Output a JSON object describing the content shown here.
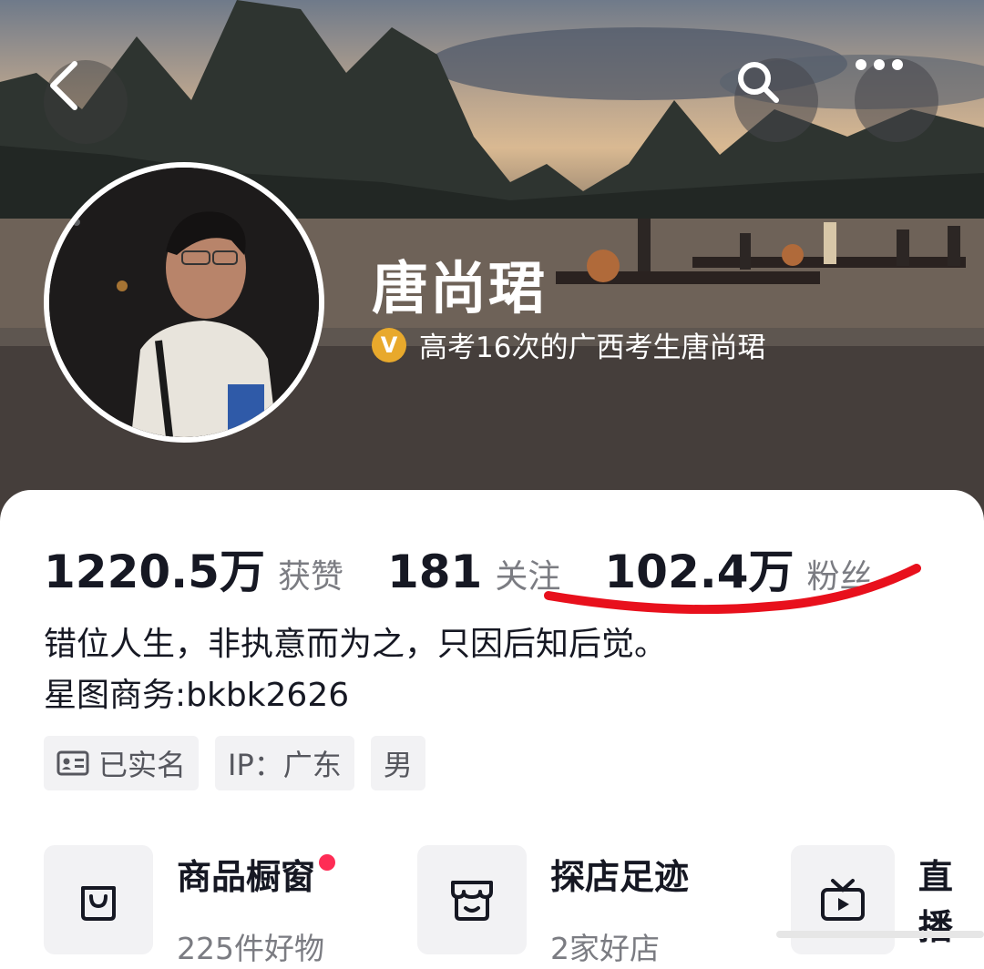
{
  "header": {
    "back_icon": "chevron-left-icon",
    "search_icon": "search-icon",
    "more_icon": "ellipsis-icon"
  },
  "profile": {
    "nickname": "唐尚珺",
    "verified_badge": "V",
    "verified_text": "高考16次的广西考生唐尚珺",
    "badge_color": "#e8a92c"
  },
  "stats": [
    {
      "value": "1220.5万",
      "label": "获赞"
    },
    {
      "value": "181",
      "label": "关注"
    },
    {
      "value": "102.4万",
      "label": "粉丝"
    }
  ],
  "bio": {
    "line1": "错位人生，非执意而为之，只因后知后觉。",
    "line2": "星图商务:bkbk2626"
  },
  "tags": {
    "verified": "已实名",
    "ip": "IP：广东",
    "gender": "男"
  },
  "features": [
    {
      "title": "商品橱窗",
      "subtitle": "225件好物",
      "icon": "shopping-bag-icon",
      "has_dot": true
    },
    {
      "title": "探店足迹",
      "subtitle": "2家好店",
      "icon": "store-icon",
      "has_dot": false
    },
    {
      "title": "直播",
      "subtitle": "",
      "icon": "tv-icon",
      "has_dot": false
    }
  ],
  "colors": {
    "accent_red": "#fe2c55",
    "annotation_red": "#e8101c",
    "text_primary": "#161823",
    "text_secondary": "#7b7c82"
  }
}
